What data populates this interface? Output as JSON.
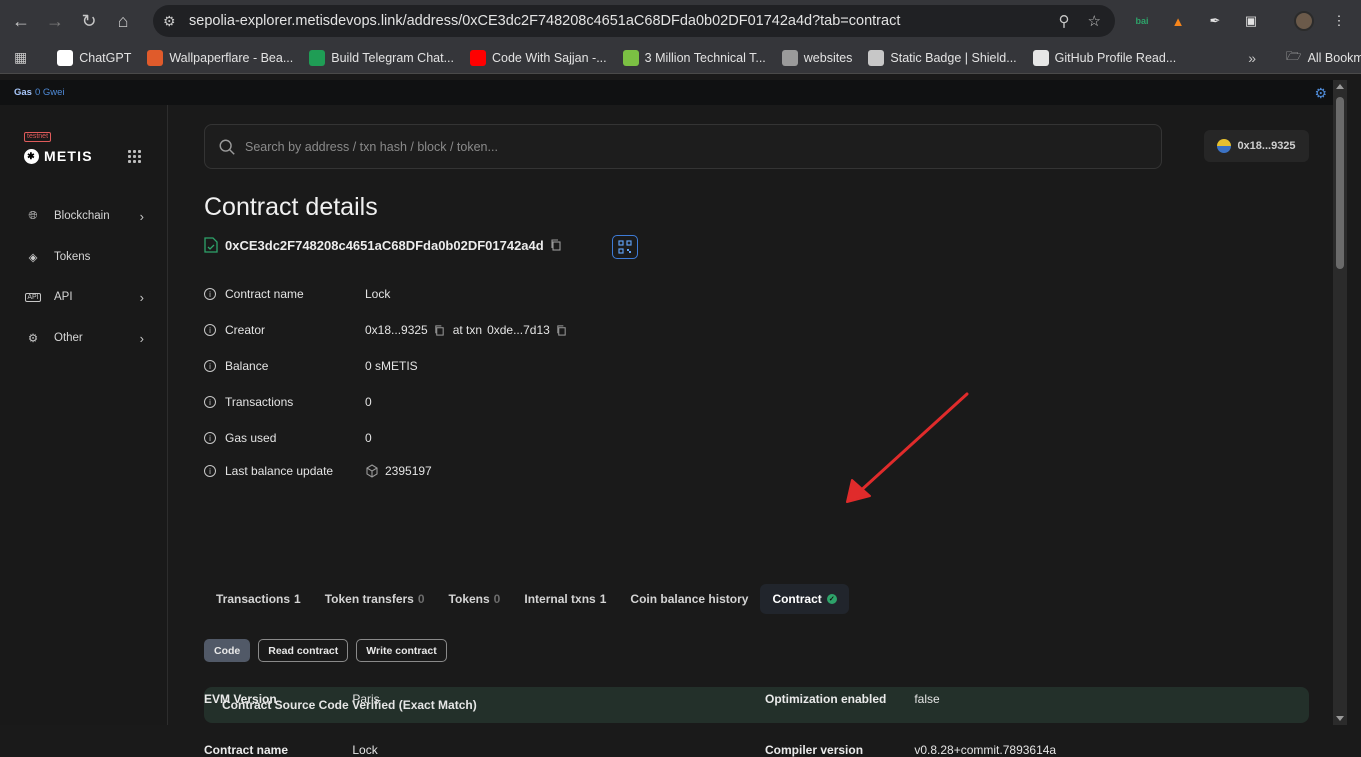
{
  "browser": {
    "url": "sepolia-explorer.metisdevops.link/address/0xCE3dc2F748208c4651aC68DFda0b02DF01742a4d?tab=contract",
    "bookmarks": [
      {
        "label": "ChatGPT",
        "color": "#ffffff"
      },
      {
        "label": "Wallpaperflare - Bea...",
        "color": "#e05b2b"
      },
      {
        "label": "Build Telegram Chat...",
        "color": "#1f9d55"
      },
      {
        "label": "Code With Sajjan -...",
        "color": "#ff0000"
      },
      {
        "label": "3 Million Technical T...",
        "color": "#7bc043"
      },
      {
        "label": "websites",
        "color": "#9a9a9a"
      },
      {
        "label": "Static Badge | Shield...",
        "color": "#c7c7c7"
      },
      {
        "label": "GitHub Profile Read...",
        "color": "#e6e6e6"
      }
    ],
    "all_bookmarks": "All Bookmarks",
    "overflow": "»"
  },
  "gas": {
    "label": "Gas",
    "value": "0 Gwei"
  },
  "sidebar": {
    "badge": "testnet",
    "brand": "METIS",
    "items": [
      {
        "label": "Blockchain",
        "icon": "globe-icon",
        "chevron": true
      },
      {
        "label": "Tokens",
        "icon": "coins-icon",
        "chevron": false
      },
      {
        "label": "API",
        "icon": "api-icon",
        "chevron": true
      },
      {
        "label": "Other",
        "icon": "gear-icon",
        "chevron": true
      }
    ]
  },
  "search": {
    "placeholder": "Search by address / txn hash / block / token..."
  },
  "wallet": {
    "label": "0x18...9325"
  },
  "page": {
    "title": "Contract details",
    "address": "0xCE3dc2F748208c4651aC68DFda0b02DF01742a4d"
  },
  "details": {
    "contract_name": {
      "label": "Contract name",
      "value": "Lock"
    },
    "creator": {
      "label": "Creator",
      "value": "0x18...9325",
      "at_txn": "at txn",
      "txn": "0xde...7d13"
    },
    "balance": {
      "label": "Balance",
      "value": "0 sMETIS"
    },
    "transactions": {
      "label": "Transactions",
      "value": "0"
    },
    "gas_used": {
      "label": "Gas used",
      "value": "0"
    },
    "last_balance_update": {
      "label": "Last balance update",
      "value": "2395197"
    }
  },
  "tabs": [
    {
      "label": "Transactions",
      "count": "1"
    },
    {
      "label": "Token transfers",
      "count": "0"
    },
    {
      "label": "Tokens",
      "count": "0"
    },
    {
      "label": "Internal txns",
      "count": "1"
    },
    {
      "label": "Coin balance history",
      "count": ""
    },
    {
      "label": "Contract",
      "count": ""
    }
  ],
  "subtabs": [
    "Code",
    "Read contract",
    "Write contract"
  ],
  "verified_banner": "Contract Source Code Verified (Exact Match)",
  "contract_meta": {
    "contract_name": {
      "label": "Contract name",
      "value": "Lock"
    },
    "evm_version": {
      "label": "EVM Version",
      "value": "Paris"
    },
    "compiler_version": {
      "label": "Compiler version",
      "value": "v0.8.28+commit.7893614a"
    },
    "optimization": {
      "label": "Optimization enabled",
      "value": "false"
    }
  },
  "colors": {
    "accent": "#5f9ef0",
    "arrow": "#e02b2b",
    "verified_bg": "#23302a"
  }
}
